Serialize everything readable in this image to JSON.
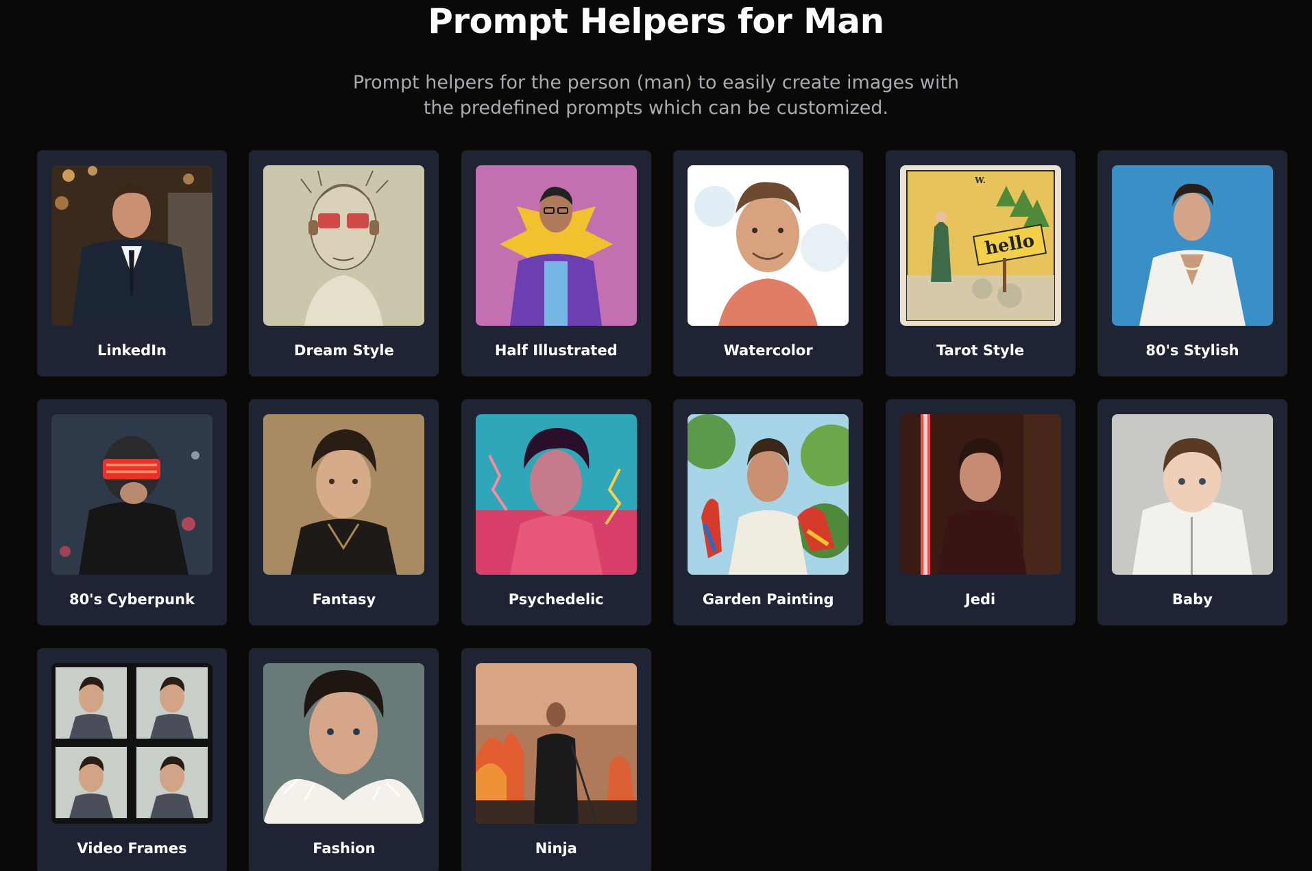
{
  "header": {
    "title": "Prompt Helpers for Man",
    "subtitle_line1": "Prompt helpers for the person (man) to easily create images with",
    "subtitle_line2": "the predefined prompts which can be customized."
  },
  "cards": [
    {
      "label": "LinkedIn"
    },
    {
      "label": "Dream Style"
    },
    {
      "label": "Half Illustrated"
    },
    {
      "label": "Watercolor"
    },
    {
      "label": "Tarot Style",
      "sign_text": "hello",
      "card_mark": "W."
    },
    {
      "label": "80's Stylish"
    },
    {
      "label": "80's Cyberpunk"
    },
    {
      "label": "Fantasy"
    },
    {
      "label": "Psychedelic"
    },
    {
      "label": "Garden Painting"
    },
    {
      "label": "Jedi"
    },
    {
      "label": "Baby"
    },
    {
      "label": "Video Frames"
    },
    {
      "label": "Fashion"
    },
    {
      "label": "Ninja"
    }
  ]
}
